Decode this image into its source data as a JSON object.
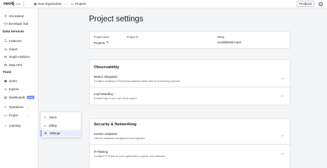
{
  "topbar": {
    "logo_text": "neo4j",
    "logo_sub": "Aura",
    "org_label": "New Organization",
    "project_label": "Project0",
    "feedback_label": "Feedback",
    "help_icon": "?"
  },
  "sidebar": {
    "get_started": "Get started",
    "developer_hub": "Developer hub",
    "data_services_heading": "Data services",
    "instances": "Instances",
    "import": "Import",
    "graph_analytics": "Graph Analytics",
    "data_apis": "Data APIs",
    "tools_heading": "Tools",
    "query": "Query",
    "explore": "Explore",
    "dashboards": "Dashboards",
    "dashboards_badge": "New",
    "operations": "Operations",
    "project": "Project",
    "learning": "Learning"
  },
  "project_submenu": {
    "users": "Users",
    "billing": "Billing",
    "settings": "Settings"
  },
  "main": {
    "title": "Project settings",
    "info": {
      "project_name_label": "Project name",
      "project_name_value": "Project1",
      "project_id_label": "Project ID",
      "billing_label": "Billing",
      "billing_value": "Credit/Debit Card"
    },
    "observability": {
      "heading": "Observability",
      "metrics_title": "Metrics integration",
      "metrics_desc": "Configure scraping of Neo4j Aura instance metric data for monitoring purposes",
      "log_title": "Log forwarding",
      "log_desc": "Forward logs to your own cloud project"
    },
    "security": {
      "heading": "Security & Networking",
      "endpoints_title": "Custom endpoints",
      "endpoints_desc": "Used for database management and migration",
      "ip_title": "IP Filtering",
      "ip_desc": "Configure IP Filters for your organization, projects, and instances."
    }
  },
  "colors": {
    "accent": "#4f6df5",
    "badge": "#6f8cff",
    "background": "#f4f5f7"
  }
}
